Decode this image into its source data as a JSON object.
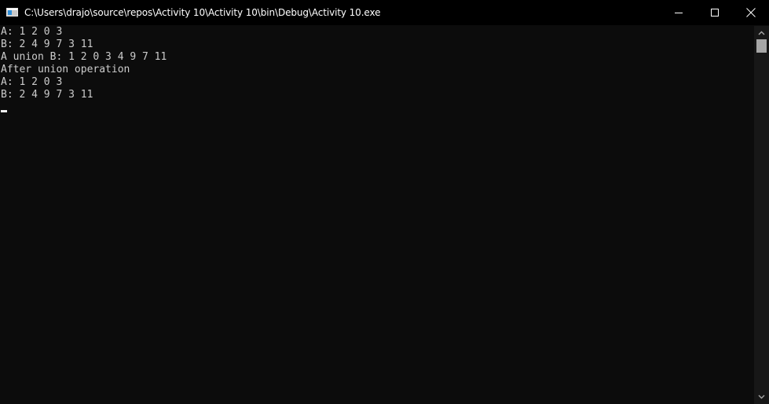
{
  "window": {
    "title": "C:\\Users\\drajo\\source\\repos\\Activity 10\\Activity 10\\bin\\Debug\\Activity 10.exe"
  },
  "console": {
    "lines": [
      "A: 1 2 0 3",
      "B: 2 4 9 7 3 11",
      "A union B: 1 2 0 3 4 9 7 11",
      "After union operation",
      "A: 1 2 0 3",
      "B: 2 4 9 7 3 11"
    ]
  },
  "icons": {
    "app": "console-app-icon",
    "minimize": "minimize-icon",
    "maximize": "maximize-icon",
    "close": "close-icon",
    "scroll_up": "chevron-up-icon",
    "scroll_down": "chevron-down-icon"
  },
  "colors": {
    "titlebar_bg": "#000000",
    "console_bg": "#0c0c0c",
    "console_text": "#cccccc",
    "scrollbar_bg": "#171717",
    "scroll_thumb": "#a6a6a6"
  }
}
